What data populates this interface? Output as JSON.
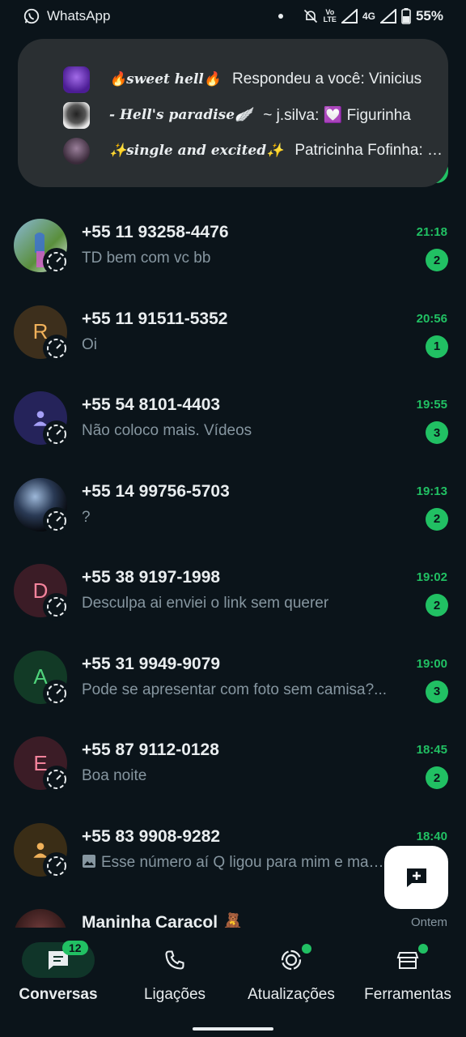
{
  "status_bar": {
    "app_name": "WhatsApp",
    "volte_top": "Vo",
    "volte_bottom": "LTE",
    "network": "4G",
    "battery": "55%"
  },
  "notification": {
    "items": [
      {
        "group": "🔥sweet hell🔥",
        "text": "Respondeu a você: Vinicius"
      },
      {
        "group": "- Hell's paradise🪽",
        "text": "~ j.silva: 💟 Figurinha"
      },
      {
        "group": "✨single and excited✨",
        "text": "Patricinha Fofinha: que"
      }
    ]
  },
  "chats": [
    {
      "name": "+55 11 93258-4476",
      "preview": "TD bem com vc bb",
      "time": "21:18",
      "unread": "2",
      "avatar_letter": "",
      "avatar_color": "#6aa0c8"
    },
    {
      "name": "+55 11 91511-5352",
      "preview": "Oi",
      "time": "20:56",
      "unread": "1",
      "avatar_letter": "R",
      "avatar_color": "#3d2f1c",
      "letter_color": "#f0b15a"
    },
    {
      "name": "+55 54 8101-4403",
      "preview": "Não coloco mais. Vídeos",
      "time": "19:55",
      "unread": "3",
      "avatar_letter": "",
      "avatar_color": "#25235a",
      "person_color": "#a59ff7"
    },
    {
      "name": "+55 14 99756-5703",
      "preview": "?",
      "time": "19:13",
      "unread": "2",
      "avatar_letter": "",
      "avatar_color": "#1a2230"
    },
    {
      "name": "+55 38 9197-1998",
      "preview": "Desculpa ai enviei o link sem querer",
      "time": "19:02",
      "unread": "2",
      "avatar_letter": "D",
      "avatar_color": "#3b1c26",
      "letter_color": "#f4839c"
    },
    {
      "name": "+55 31 9949-9079",
      "preview": "Pode se apresentar com foto sem camisa?...",
      "time": "19:00",
      "unread": "3",
      "avatar_letter": "A",
      "avatar_color": "#123a26",
      "letter_color": "#4fd37b"
    },
    {
      "name": "+55 87 9112-0128",
      "preview": "Boa noite",
      "time": "18:45",
      "unread": "2",
      "avatar_letter": "E",
      "avatar_color": "#3b1c26",
      "letter_color": "#f4839c"
    },
    {
      "name": "+55 83 9908-9282",
      "preview": "Esse número aí Q ligou para mim e mandou",
      "time": "18:40",
      "unread": "",
      "avatar_letter": "",
      "avatar_color": "#3a2d16",
      "person_color": "#f0b15a",
      "media": true
    },
    {
      "name": "Maninha Caracol 🧸",
      "preview": "",
      "time": "Ontem",
      "unread": "",
      "avatar_letter": "",
      "avatar_color": "#3a1c1c",
      "time_grey": true
    }
  ],
  "bottom_nav": {
    "conversas": "Conversas",
    "conversas_count": "12",
    "ligacoes": "Ligações",
    "atualizacoes": "Atualizações",
    "ferramentas": "Ferramentas"
  },
  "colors": {
    "background": "#0b141a",
    "accent": "#21c063",
    "notification_bg": "#2a2f32"
  }
}
